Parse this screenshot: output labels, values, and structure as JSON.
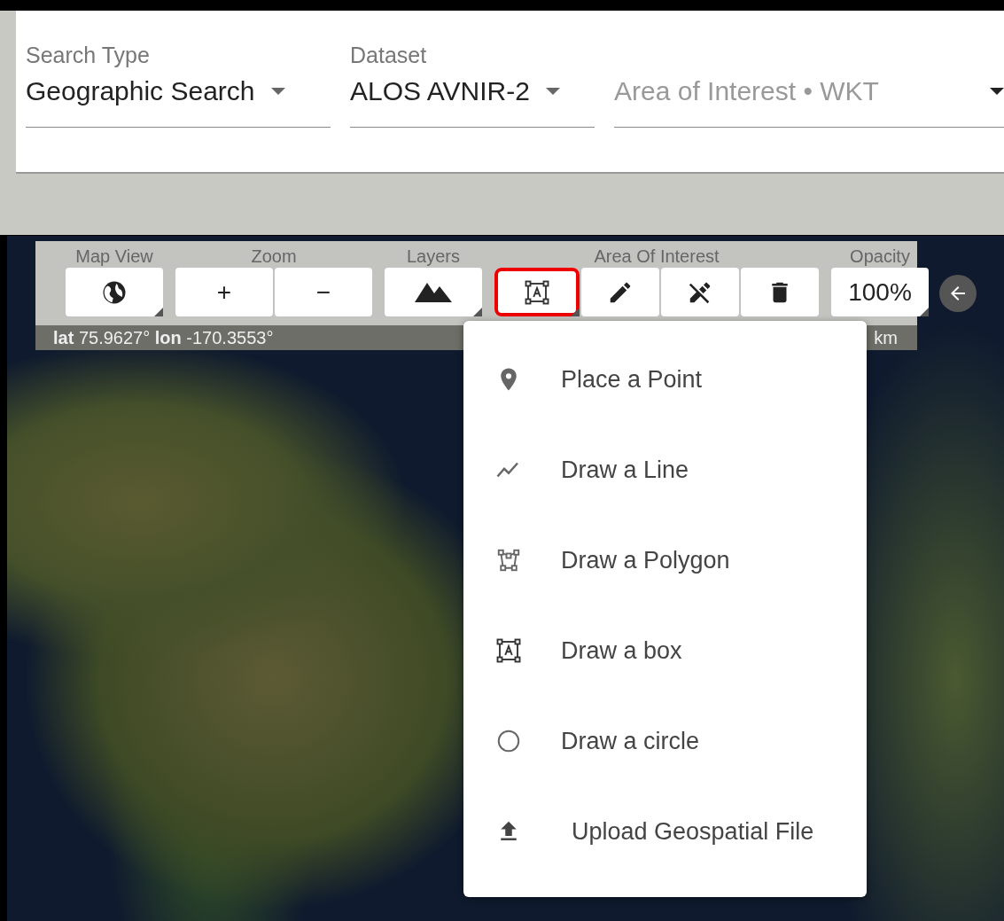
{
  "search_bar": {
    "fields": [
      {
        "kind": "select",
        "label": "Search Type",
        "value": "Geographic Search"
      },
      {
        "kind": "select",
        "label": "Dataset",
        "value": "ALOS AVNIR-2"
      },
      {
        "kind": "input",
        "placeholder": "Area of Interest • WKT"
      }
    ]
  },
  "map_toolbar": {
    "groups": [
      {
        "label": "Map View",
        "buttons": [
          {
            "kind": "globe",
            "dropdown": true,
            "highlighted": false
          }
        ]
      },
      {
        "label": "Zoom",
        "buttons": [
          {
            "kind": "text",
            "text": "+",
            "dropdown": false,
            "highlighted": false
          },
          {
            "kind": "text",
            "text": "−",
            "dropdown": false,
            "highlighted": false
          }
        ]
      },
      {
        "label": "Layers",
        "buttons": [
          {
            "kind": "mountains",
            "dropdown": true,
            "highlighted": false
          }
        ]
      },
      {
        "label": "Area Of Interest",
        "buttons": [
          {
            "kind": "box",
            "dropdown": true,
            "highlighted": true
          },
          {
            "kind": "pencil",
            "dropdown": false,
            "highlighted": false
          },
          {
            "kind": "edit",
            "dropdown": false,
            "highlighted": false
          },
          {
            "kind": "trash",
            "dropdown": false,
            "highlighted": false
          }
        ]
      },
      {
        "label": "Opacity",
        "buttons": [
          {
            "kind": "text",
            "text": "100%",
            "dropdown": true,
            "highlighted": false
          }
        ]
      }
    ],
    "coordinates": "**lat** 75.9627°   **lon** -170.3553°",
    "scale": "km"
  },
  "draw_menu": {
    "items": [
      {
        "kind": "point",
        "label": "Place a Point"
      },
      {
        "kind": "line",
        "label": "Draw a Line"
      },
      {
        "kind": "polygon",
        "label": "Draw a Polygon"
      },
      {
        "kind": "box",
        "label": "Draw a box"
      },
      {
        "kind": "circle",
        "label": "Draw a circle"
      },
      {
        "kind": "upload",
        "label": "Upload Geospatial File"
      }
    ]
  }
}
